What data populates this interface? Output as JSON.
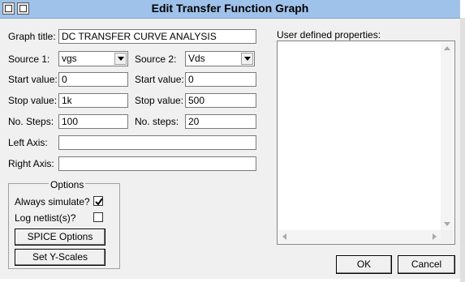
{
  "window": {
    "title": "Edit Transfer Function Graph"
  },
  "form": {
    "graph_title_label": "Graph title:",
    "graph_title_value": "DC TRANSFER CURVE ANALYSIS",
    "source1_label": "Source 1:",
    "source1_value": "vgs",
    "source2_label": "Source 2:",
    "source2_value": "Vds",
    "start1_label": "Start value:",
    "start1_value": "0",
    "start2_label": "Start value:",
    "start2_value": "0",
    "stop1_label": "Stop value:",
    "stop1_value": "1k",
    "stop2_label": "Stop value:",
    "stop2_value": "500",
    "steps1_label": "No. Steps:",
    "steps1_value": "100",
    "steps2_label": "No. steps:",
    "steps2_value": "20",
    "left_axis_label": "Left Axis:",
    "left_axis_value": "",
    "right_axis_label": "Right Axis:",
    "right_axis_value": ""
  },
  "options": {
    "title": "Options",
    "always_simulate_label": "Always simulate?",
    "always_simulate_checked": true,
    "log_netlist_label": "Log netlist(s)?",
    "log_netlist_checked": false,
    "spice_button": "SPICE Options",
    "yscales_button": "Set Y-Scales"
  },
  "properties": {
    "label": "User defined properties:"
  },
  "buttons": {
    "ok": "OK",
    "cancel": "Cancel"
  }
}
